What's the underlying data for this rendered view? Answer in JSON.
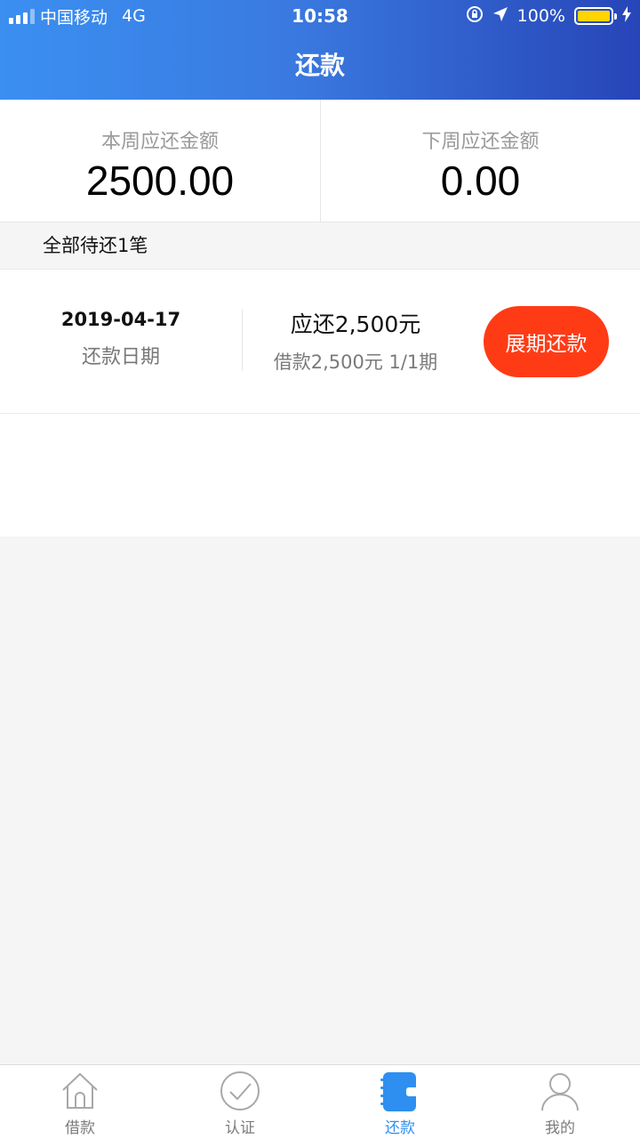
{
  "status_bar": {
    "carrier": "中国移动",
    "network": "4G",
    "time": "10:58",
    "battery": "100%",
    "icons": [
      "signal-icon",
      "orientation-lock-icon",
      "location-arrow-icon",
      "battery-icon",
      "charging-icon"
    ]
  },
  "nav": {
    "title": "还款"
  },
  "summary": {
    "this_week_label": "本周应还金额",
    "this_week_value": "2500.00",
    "next_week_label": "下周应还金额",
    "next_week_value": "0.00"
  },
  "pending": {
    "text": "全部待还1笔"
  },
  "loans": [
    {
      "date": "2019-04-17",
      "date_label": "还款日期",
      "due": "应还2,500元",
      "detail": "借款2,500元 1/1期",
      "button": "展期还款"
    }
  ],
  "tabs": [
    {
      "label": "借款",
      "icon": "home-icon",
      "active": false
    },
    {
      "label": "认证",
      "icon": "check-circle-icon",
      "active": false
    },
    {
      "label": "还款",
      "icon": "wallet-icon",
      "active": true
    },
    {
      "label": "我的",
      "icon": "user-icon",
      "active": false
    }
  ],
  "colors": {
    "header_start": "#3b8ff1",
    "header_end": "#2745b8",
    "accent": "#2e8ff0",
    "button": "#ff3b16",
    "battery": "#ffd400"
  }
}
